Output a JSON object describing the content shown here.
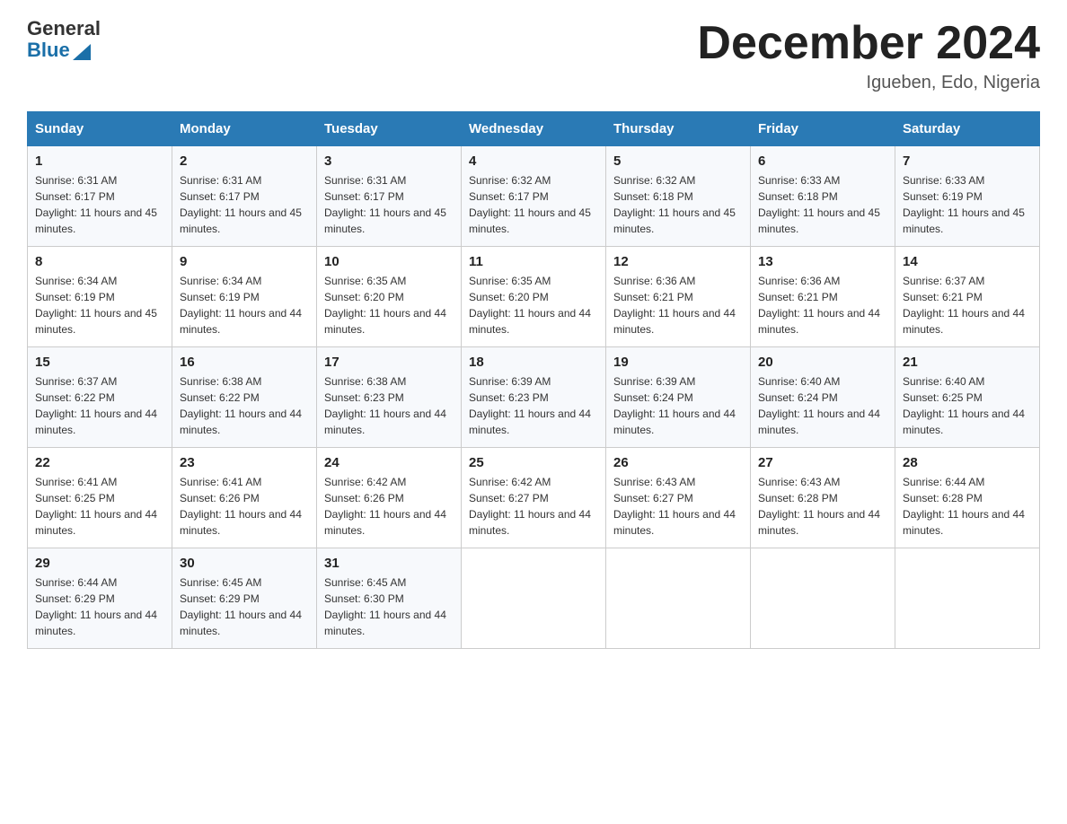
{
  "header": {
    "logo_general": "General",
    "logo_blue": "Blue",
    "month_year": "December 2024",
    "location": "Igueben, Edo, Nigeria"
  },
  "days_of_week": [
    "Sunday",
    "Monday",
    "Tuesday",
    "Wednesday",
    "Thursday",
    "Friday",
    "Saturday"
  ],
  "weeks": [
    [
      {
        "day": "1",
        "sunrise": "6:31 AM",
        "sunset": "6:17 PM",
        "daylight": "11 hours and 45 minutes."
      },
      {
        "day": "2",
        "sunrise": "6:31 AM",
        "sunset": "6:17 PM",
        "daylight": "11 hours and 45 minutes."
      },
      {
        "day": "3",
        "sunrise": "6:31 AM",
        "sunset": "6:17 PM",
        "daylight": "11 hours and 45 minutes."
      },
      {
        "day": "4",
        "sunrise": "6:32 AM",
        "sunset": "6:17 PM",
        "daylight": "11 hours and 45 minutes."
      },
      {
        "day": "5",
        "sunrise": "6:32 AM",
        "sunset": "6:18 PM",
        "daylight": "11 hours and 45 minutes."
      },
      {
        "day": "6",
        "sunrise": "6:33 AM",
        "sunset": "6:18 PM",
        "daylight": "11 hours and 45 minutes."
      },
      {
        "day": "7",
        "sunrise": "6:33 AM",
        "sunset": "6:19 PM",
        "daylight": "11 hours and 45 minutes."
      }
    ],
    [
      {
        "day": "8",
        "sunrise": "6:34 AM",
        "sunset": "6:19 PM",
        "daylight": "11 hours and 45 minutes."
      },
      {
        "day": "9",
        "sunrise": "6:34 AM",
        "sunset": "6:19 PM",
        "daylight": "11 hours and 44 minutes."
      },
      {
        "day": "10",
        "sunrise": "6:35 AM",
        "sunset": "6:20 PM",
        "daylight": "11 hours and 44 minutes."
      },
      {
        "day": "11",
        "sunrise": "6:35 AM",
        "sunset": "6:20 PM",
        "daylight": "11 hours and 44 minutes."
      },
      {
        "day": "12",
        "sunrise": "6:36 AM",
        "sunset": "6:21 PM",
        "daylight": "11 hours and 44 minutes."
      },
      {
        "day": "13",
        "sunrise": "6:36 AM",
        "sunset": "6:21 PM",
        "daylight": "11 hours and 44 minutes."
      },
      {
        "day": "14",
        "sunrise": "6:37 AM",
        "sunset": "6:21 PM",
        "daylight": "11 hours and 44 minutes."
      }
    ],
    [
      {
        "day": "15",
        "sunrise": "6:37 AM",
        "sunset": "6:22 PM",
        "daylight": "11 hours and 44 minutes."
      },
      {
        "day": "16",
        "sunrise": "6:38 AM",
        "sunset": "6:22 PM",
        "daylight": "11 hours and 44 minutes."
      },
      {
        "day": "17",
        "sunrise": "6:38 AM",
        "sunset": "6:23 PM",
        "daylight": "11 hours and 44 minutes."
      },
      {
        "day": "18",
        "sunrise": "6:39 AM",
        "sunset": "6:23 PM",
        "daylight": "11 hours and 44 minutes."
      },
      {
        "day": "19",
        "sunrise": "6:39 AM",
        "sunset": "6:24 PM",
        "daylight": "11 hours and 44 minutes."
      },
      {
        "day": "20",
        "sunrise": "6:40 AM",
        "sunset": "6:24 PM",
        "daylight": "11 hours and 44 minutes."
      },
      {
        "day": "21",
        "sunrise": "6:40 AM",
        "sunset": "6:25 PM",
        "daylight": "11 hours and 44 minutes."
      }
    ],
    [
      {
        "day": "22",
        "sunrise": "6:41 AM",
        "sunset": "6:25 PM",
        "daylight": "11 hours and 44 minutes."
      },
      {
        "day": "23",
        "sunrise": "6:41 AM",
        "sunset": "6:26 PM",
        "daylight": "11 hours and 44 minutes."
      },
      {
        "day": "24",
        "sunrise": "6:42 AM",
        "sunset": "6:26 PM",
        "daylight": "11 hours and 44 minutes."
      },
      {
        "day": "25",
        "sunrise": "6:42 AM",
        "sunset": "6:27 PM",
        "daylight": "11 hours and 44 minutes."
      },
      {
        "day": "26",
        "sunrise": "6:43 AM",
        "sunset": "6:27 PM",
        "daylight": "11 hours and 44 minutes."
      },
      {
        "day": "27",
        "sunrise": "6:43 AM",
        "sunset": "6:28 PM",
        "daylight": "11 hours and 44 minutes."
      },
      {
        "day": "28",
        "sunrise": "6:44 AM",
        "sunset": "6:28 PM",
        "daylight": "11 hours and 44 minutes."
      }
    ],
    [
      {
        "day": "29",
        "sunrise": "6:44 AM",
        "sunset": "6:29 PM",
        "daylight": "11 hours and 44 minutes."
      },
      {
        "day": "30",
        "sunrise": "6:45 AM",
        "sunset": "6:29 PM",
        "daylight": "11 hours and 44 minutes."
      },
      {
        "day": "31",
        "sunrise": "6:45 AM",
        "sunset": "6:30 PM",
        "daylight": "11 hours and 44 minutes."
      },
      null,
      null,
      null,
      null
    ]
  ]
}
